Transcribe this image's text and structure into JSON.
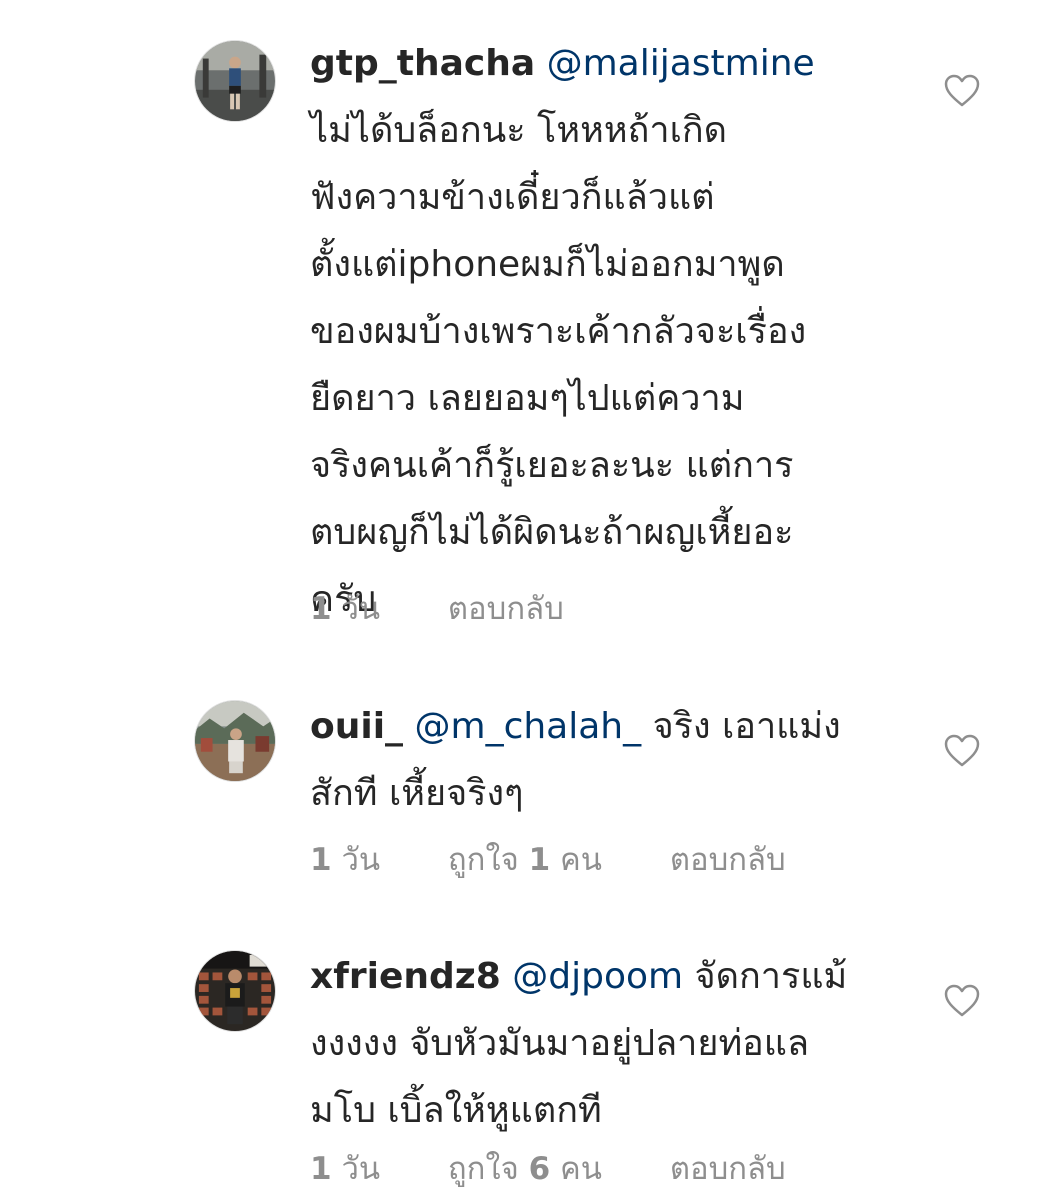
{
  "comments": [
    {
      "username": "gtp_thacha",
      "mention": "@malijastmine",
      "lines": [
        "ไม่ได้บล็อกนะ โหหหถ้าเกิด",
        "ฟังความข้างเดี๋ยวก็แล้วแต่",
        "ตั้งแต่iphoneผมก็ไม่ออกมาพูด",
        "ของผมบ้างเพราะเค้ากลัวจะเรื่อง",
        "ยืดยาว เลยยอมๆไปแต่ความ",
        "จริงคนเค้าก็รู้เยอะละนะ แต่การ",
        "ตบผญก็ไม่ได้ผิดนะถ้าผญเหี้ยอะ",
        "ครับ"
      ],
      "time_num": "1",
      "time_unit": "วัน",
      "reply_label": "ตอบกลับ"
    },
    {
      "username": "ouii_",
      "mention": "@m_chalah_",
      "first_line_rest": "จริง เอาแม่ง",
      "lines": [
        "สักที เหี้ยจริงๆ"
      ],
      "time_num": "1",
      "time_unit": "วัน",
      "likes_prefix": "ถูกใจ",
      "likes_num": "1",
      "likes_suffix": "คน",
      "reply_label": "ตอบกลับ"
    },
    {
      "username": "xfriendz8",
      "mention": "@djpoom",
      "first_line_rest": "จัดการแม้",
      "lines": [
        "งงงงง จับหัวมันมาอยู่ปลายท่อแล",
        "มโบ เบิ้ลให้หูแตกที"
      ],
      "time_num": "1",
      "time_unit": "วัน",
      "likes_prefix": "ถูกใจ",
      "likes_num": "6",
      "likes_suffix": "คน",
      "reply_label": "ตอบกลับ"
    }
  ],
  "icons": {
    "like": "heart-outline-icon"
  },
  "colors": {
    "text": "#262626",
    "mention": "#003569",
    "meta": "#8e8e8e"
  }
}
